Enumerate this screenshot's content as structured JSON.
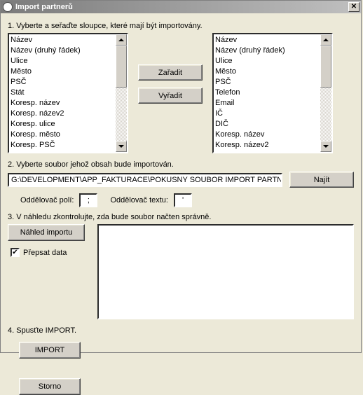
{
  "window": {
    "title": "Import partnerů",
    "close_glyph": "✕"
  },
  "step1": {
    "label": "1. Vyberte a seřaďte sloupce, které mají být importovány.",
    "left_list": [
      "Název",
      "Název (druhý řádek)",
      "Ulice",
      "Město",
      "PSČ",
      "Stát",
      "Koresp. název",
      "Koresp. název2",
      "Koresp. ulice",
      "Koresp. město",
      "Koresp. PSČ"
    ],
    "right_list": [
      "Název",
      "Název (druhý řádek)",
      "Ulice",
      "Město",
      "PSČ",
      "Telefon",
      "Email",
      "IČ",
      "DIČ",
      "Koresp. název",
      "Koresp. název2"
    ],
    "btn_add": "Zařadit",
    "btn_remove": "Vyřadit"
  },
  "step2": {
    "label": "2. Vyberte soubor jehož obsah bude importován.",
    "path": "G:\\DEVELOPMENT\\APP_FAKTURACE\\POKUSNY SOUBOR IMPORT PARTNEF",
    "btn_find": "Najít",
    "field_sep_label": "Oddělovač polí:",
    "field_sep_value": ";",
    "text_sep_label": "Oddělovač textu:",
    "text_sep_value": "'"
  },
  "step3": {
    "label": "3. V náhledu zkontrolujte, zda bude soubor načten správně.",
    "btn_preview": "Náhled importu",
    "chk_overwrite_label": "Přepsat data",
    "chk_overwrite_checked": true
  },
  "step4": {
    "label": "4. Spusťte IMPORT.",
    "btn_import": "IMPORT",
    "btn_storno": "Storno"
  }
}
